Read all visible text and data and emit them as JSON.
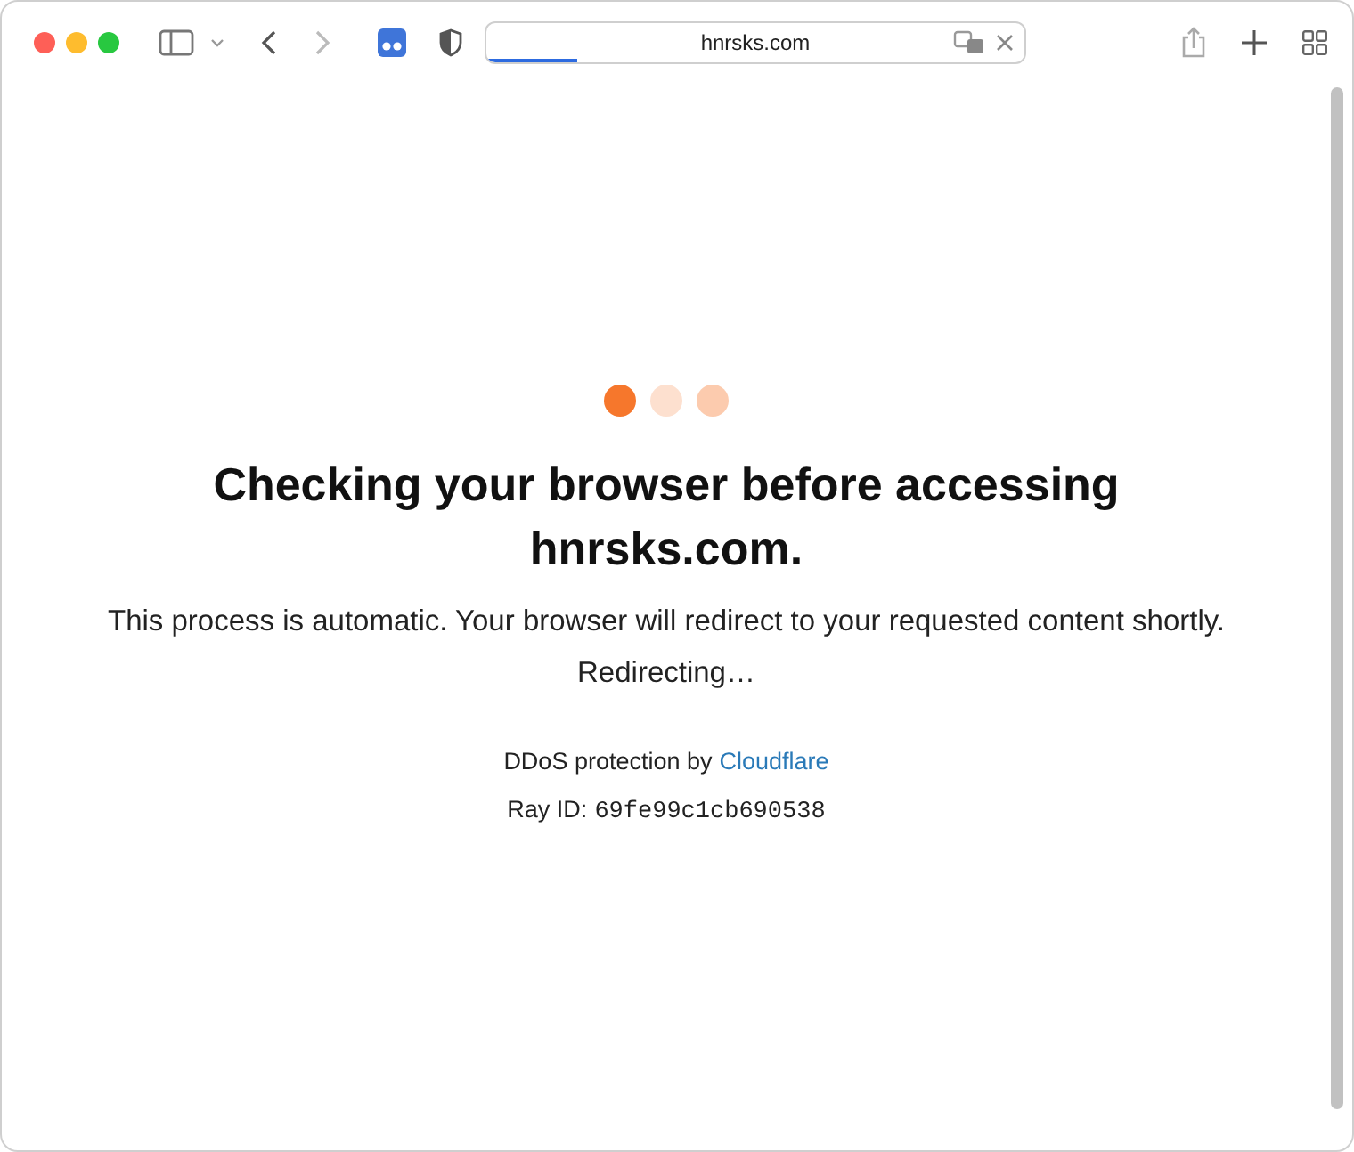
{
  "toolbar": {
    "address": "hnrsks.com",
    "load_progress": {
      "level": 0.17
    }
  },
  "page": {
    "dots": [
      {
        "color": "#f6772c"
      },
      {
        "color": "#fde0cf"
      },
      {
        "color": "#fccbae"
      }
    ],
    "heading": "Checking your browser before accessing hnrsks.com.",
    "message": "This process is automatic. Your browser will redirect to your requested content shortly.",
    "status": "Redirecting…",
    "protection": {
      "text": "DDoS protection by",
      "link": "Cloudflare"
    },
    "ray": {
      "label": "Ray ID:",
      "value": "69fe99c1cb690538"
    }
  }
}
